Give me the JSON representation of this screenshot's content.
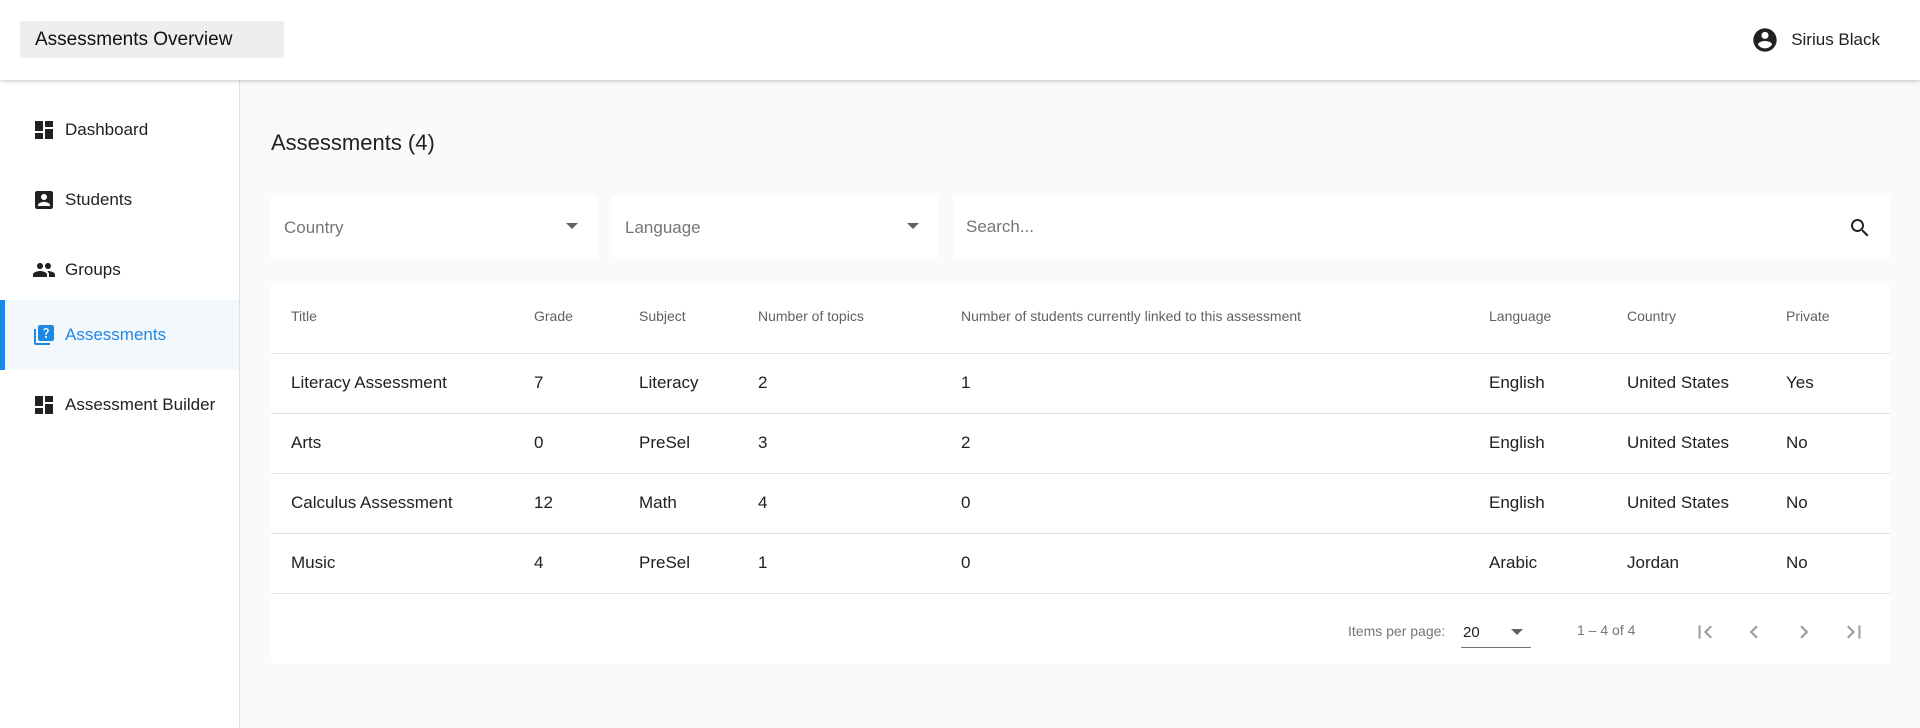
{
  "header": {
    "app_title": "Assessments Overview",
    "user_name": "Sirius Black"
  },
  "sidebar": {
    "items": [
      {
        "label": "Dashboard",
        "icon": "dashboard-icon"
      },
      {
        "label": "Students",
        "icon": "student-badge-icon"
      },
      {
        "label": "Groups",
        "icon": "groups-icon"
      },
      {
        "label": "Assessments",
        "icon": "quiz-icon",
        "active": true
      },
      {
        "label": "Assessment Builder",
        "icon": "dashboard-icon"
      }
    ]
  },
  "main": {
    "title": "Assessments (4)",
    "filters": {
      "country_label": "Country",
      "language_label": "Language",
      "search_placeholder": "Search..."
    },
    "table": {
      "columns": [
        "Title",
        "Grade",
        "Subject",
        "Number of topics",
        "Number of students currently linked to this assessment",
        "Language",
        "Country",
        "Private"
      ],
      "rows": [
        [
          "Literacy Assessment",
          "7",
          "Literacy",
          "2",
          "1",
          "English",
          "United States",
          "Yes"
        ],
        [
          "Arts",
          "0",
          "PreSel",
          "3",
          "2",
          "English",
          "United States",
          "No"
        ],
        [
          "Calculus Assessment",
          "12",
          "Math",
          "4",
          "0",
          "English",
          "United States",
          "No"
        ],
        [
          "Music",
          "4",
          "PreSel",
          "1",
          "0",
          "Arabic",
          "Jordan",
          "No"
        ]
      ]
    },
    "paginator": {
      "items_per_page_label": "Items per page:",
      "items_per_page_value": "20",
      "range_label": "1 – 4 of 4"
    }
  },
  "colors": {
    "accent": "#1e88e5",
    "active_bg": "#f3f8fd",
    "background": "#fafafa"
  }
}
